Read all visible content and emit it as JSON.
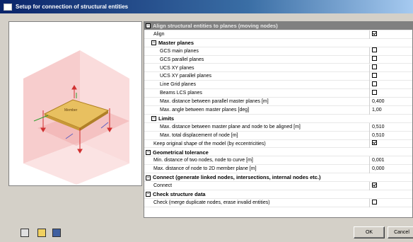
{
  "window": {
    "title": "Setup for connection of structural entities"
  },
  "preview": {
    "label": "Member"
  },
  "properties": [
    {
      "label": "Align structural entities to planes (moving nodes)",
      "kind": "group",
      "indent": 0,
      "value": ""
    },
    {
      "label": "Align",
      "kind": "check",
      "indent": 1,
      "checked": true
    },
    {
      "label": "Master planes",
      "kind": "subgroup",
      "indent": 1
    },
    {
      "label": "GCS main planes",
      "kind": "check",
      "indent": 2,
      "checked": false
    },
    {
      "label": "GCS parallel planes",
      "kind": "check",
      "indent": 2,
      "checked": false
    },
    {
      "label": "UCS XY planes",
      "kind": "check",
      "indent": 2,
      "checked": false
    },
    {
      "label": "UCS XY parallel planes",
      "kind": "check",
      "indent": 2,
      "checked": false
    },
    {
      "label": "Line Grid planes",
      "kind": "check",
      "indent": 2,
      "checked": false
    },
    {
      "label": "Beams LCS planes",
      "kind": "check",
      "indent": 2,
      "checked": false
    },
    {
      "label": "Max. distance between parallel master planes [m]",
      "kind": "value",
      "indent": 2,
      "value": "0,400"
    },
    {
      "label": "Max. angle between master planes [deg]",
      "kind": "value",
      "indent": 2,
      "value": "1,00"
    },
    {
      "label": "Limits",
      "kind": "subgroup",
      "indent": 1
    },
    {
      "label": "Max. distance between master plane and node to be aligned [m]",
      "kind": "value",
      "indent": 2,
      "value": "0,510"
    },
    {
      "label": "Max. total displacement of node [m]",
      "kind": "value",
      "indent": 2,
      "value": "0,510"
    },
    {
      "label": "Keep original shape of the model (by eccentricities)",
      "kind": "check",
      "indent": 1,
      "checked": true
    },
    {
      "label": "Geometrical tolerance",
      "kind": "group",
      "indent": 0
    },
    {
      "label": "Min. distance of two nodes, node to curve [m]",
      "kind": "value",
      "indent": 1,
      "value": "0,001"
    },
    {
      "label": "Max. distance of node to 2D member plane [m]",
      "kind": "value",
      "indent": 1,
      "value": "0,000"
    },
    {
      "label": "Connect (generate linked nodes, intersections, internal nodes etc.)",
      "kind": "group",
      "indent": 0
    },
    {
      "label": "Connect",
      "kind": "check",
      "indent": 1,
      "checked": true
    },
    {
      "label": "Check structure data",
      "kind": "group",
      "indent": 0
    },
    {
      "label": "Check (merge duplicate nodes, erase invalid entities)",
      "kind": "check",
      "indent": 1,
      "checked": false
    }
  ],
  "buttons": {
    "ok": "OK",
    "cancel": "Cancel"
  },
  "toolbar": {
    "icons": [
      "new-file-icon",
      "open-folder-icon",
      "save-disk-icon"
    ]
  }
}
